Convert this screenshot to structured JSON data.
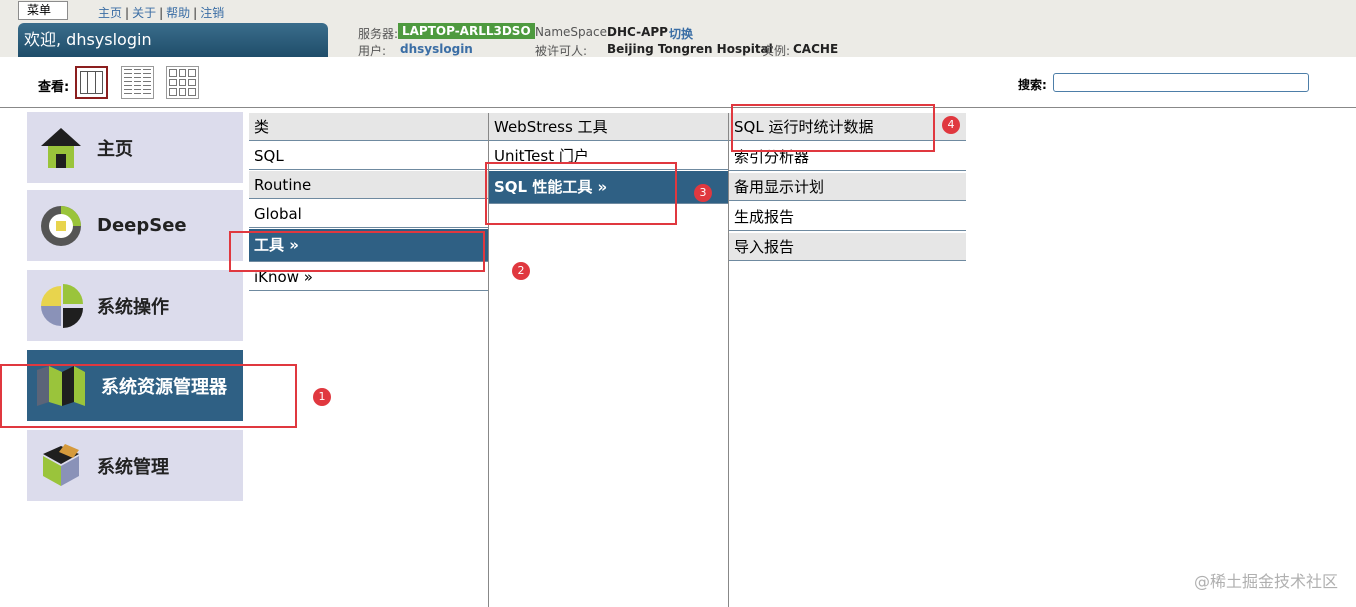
{
  "header": {
    "menu_label": "菜单",
    "links": [
      "主页",
      "关于",
      "帮助",
      "注销"
    ],
    "link_sep": "|",
    "welcome": "欢迎, dhsyslogin",
    "server_label": "服务器:",
    "server_value": "LAPTOP-ARLL3DSO",
    "namespace_label": "NameSpace:",
    "namespace_value": "DHC-APP",
    "switch_label": "切换",
    "user_label": "用户:",
    "user_value": "dhsyslogin",
    "licensee_label": "被许可人:",
    "licensee_value": "Beijing Tongren Hospital",
    "instance_label": "实例:",
    "instance_value": "CACHE"
  },
  "viewbar": {
    "view_label": "查看:",
    "search_label": "搜索:",
    "search_value": ""
  },
  "categories": [
    {
      "label": "主页",
      "icon": "home-icon"
    },
    {
      "label": "DeepSee",
      "icon": "deepsee-icon"
    },
    {
      "label": "系统操作",
      "icon": "system-operation-icon"
    },
    {
      "label": "系统资源管理器",
      "icon": "system-explorer-icon",
      "active": true
    },
    {
      "label": "系统管理",
      "icon": "system-admin-icon"
    }
  ],
  "column1": [
    "类",
    "SQL",
    "Routine",
    "Global",
    "工具 »",
    "iKnow »"
  ],
  "column2": [
    "WebStress 工具",
    "UnitTest 门户",
    "SQL 性能工具 »"
  ],
  "column3": [
    "SQL 运行时统计数据",
    "索引分析器",
    "备用显示计划",
    "生成报告",
    "导入报告"
  ],
  "annotations": [
    "1",
    "2",
    "3",
    "4"
  ],
  "watermark": "@稀土掘金技术社区",
  "colors": {
    "active_bg": "#2f6084",
    "tile_bg": "#dcdcec",
    "annotation_red": "#e0383f",
    "server_badge": "#4e9a3f"
  }
}
